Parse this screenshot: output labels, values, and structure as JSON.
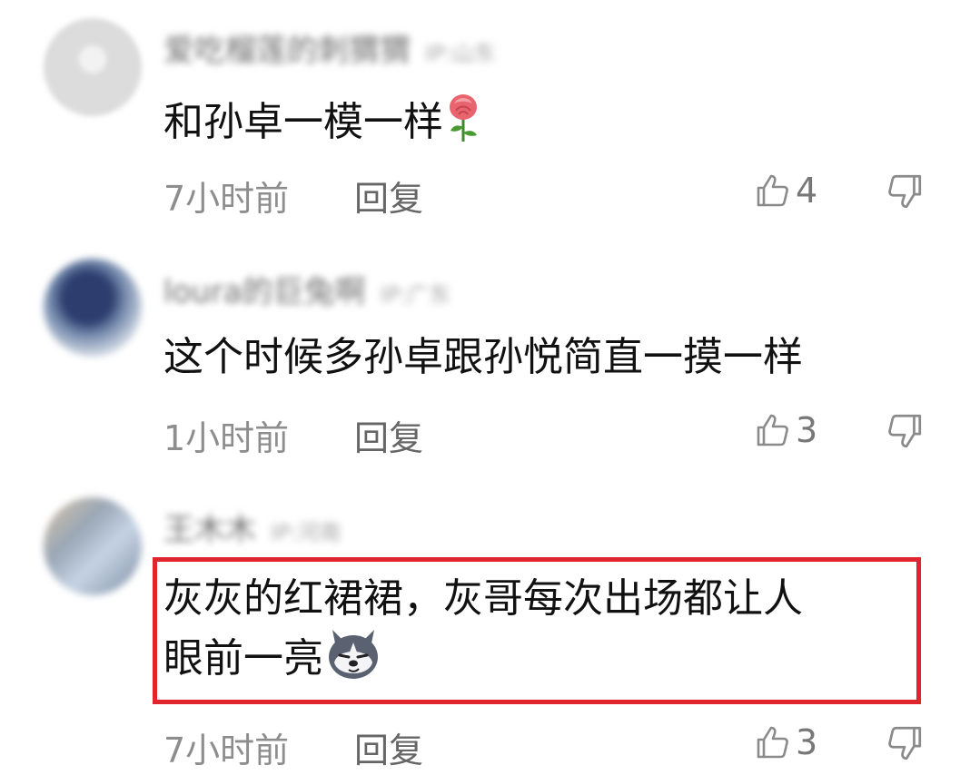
{
  "comments": [
    {
      "username": "爱吃榴莲的刺猬猬",
      "location": "IP:山东",
      "content": "和孙卓一模一样",
      "emoji": "rose-emoji",
      "time": "7小时前",
      "reply": "回复",
      "likes": "4"
    },
    {
      "username": "loura的巨兔啊",
      "location": "IP:广东",
      "content": "这个时候多孙卓跟孙悦简直一摸一样",
      "emoji": "",
      "time": "1小时前",
      "reply": "回复",
      "likes": "3"
    },
    {
      "username": "王木木",
      "location": "IP:河南",
      "content_line1": "灰灰的红裙裙，灰哥每次出场都让人",
      "content_line2": "眼前一亮",
      "emoji": "husky-emoji",
      "time": "7小时前",
      "reply": "回复",
      "likes": "3"
    }
  ],
  "colors": {
    "highlight_border": "#e0252d",
    "meta_text": "#8d8d8d",
    "content_text": "#111111"
  }
}
